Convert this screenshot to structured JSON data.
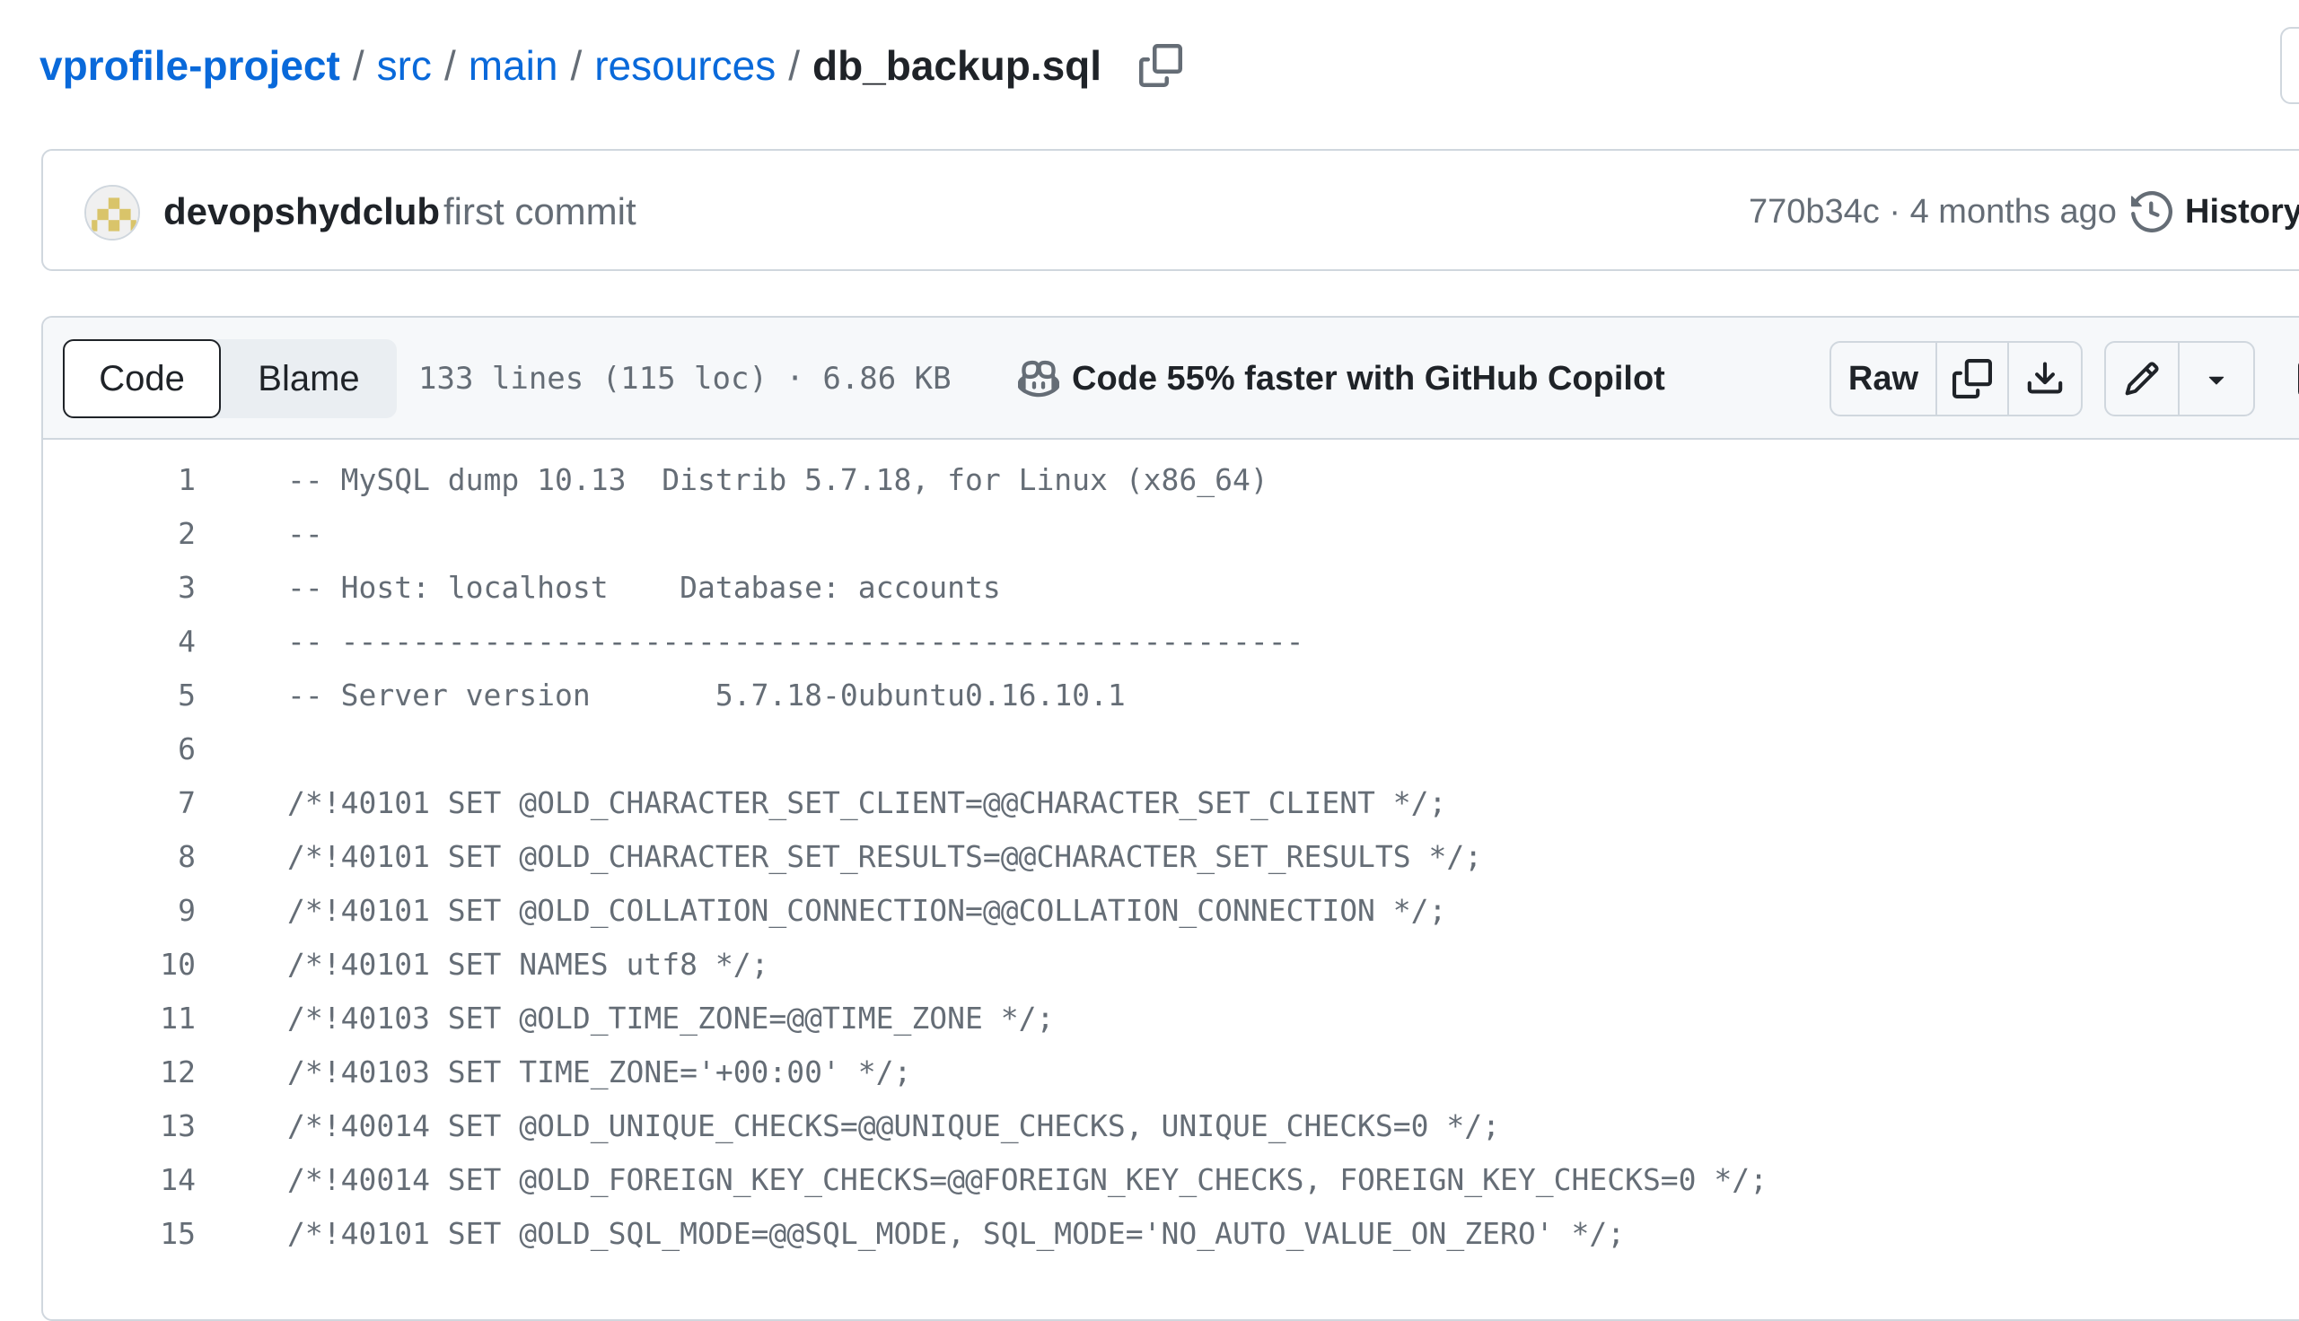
{
  "breadcrumb": {
    "repo": "vprofile-project",
    "separator": "/",
    "parts": [
      "src",
      "main",
      "resources"
    ],
    "file": "db_backup.sql"
  },
  "commit": {
    "author": "devopshydclub",
    "message": "first commit",
    "sha": "770b34c",
    "time_sep": "·",
    "time": "4 months ago",
    "history_label": "History"
  },
  "file_header": {
    "tabs": {
      "code": "Code",
      "blame": "Blame"
    },
    "info": "133 lines (115 loc) · 6.86 KB",
    "copilot": "Code 55% faster with GitHub Copilot",
    "raw": "Raw"
  },
  "code_lines": [
    {
      "n": "1",
      "text": "-- MySQL dump 10.13  Distrib 5.7.18, for Linux (x86_64)"
    },
    {
      "n": "2",
      "text": "--"
    },
    {
      "n": "3",
      "text": "-- Host: localhost    Database: accounts"
    },
    {
      "n": "4",
      "text": "-- ------------------------------------------------------"
    },
    {
      "n": "5",
      "text": "-- Server version\t5.7.18-0ubuntu0.16.10.1"
    },
    {
      "n": "6",
      "text": ""
    },
    {
      "n": "7",
      "text": "/*!40101 SET @OLD_CHARACTER_SET_CLIENT=@@CHARACTER_SET_CLIENT */;"
    },
    {
      "n": "8",
      "text": "/*!40101 SET @OLD_CHARACTER_SET_RESULTS=@@CHARACTER_SET_RESULTS */;"
    },
    {
      "n": "9",
      "text": "/*!40101 SET @OLD_COLLATION_CONNECTION=@@COLLATION_CONNECTION */;"
    },
    {
      "n": "10",
      "text": "/*!40101 SET NAMES utf8 */;"
    },
    {
      "n": "11",
      "text": "/*!40103 SET @OLD_TIME_ZONE=@@TIME_ZONE */;"
    },
    {
      "n": "12",
      "text": "/*!40103 SET TIME_ZONE='+00:00' */;"
    },
    {
      "n": "13",
      "text": "/*!40014 SET @OLD_UNIQUE_CHECKS=@@UNIQUE_CHECKS, UNIQUE_CHECKS=0 */;"
    },
    {
      "n": "14",
      "text": "/*!40014 SET @OLD_FOREIGN_KEY_CHECKS=@@FOREIGN_KEY_CHECKS, FOREIGN_KEY_CHECKS=0 */;"
    },
    {
      "n": "15",
      "text": "/*!40101 SET @OLD_SQL_MODE=@@SQL_MODE, SQL_MODE='NO_AUTO_VALUE_ON_ZERO' */;"
    }
  ],
  "icons": {
    "copy_path": "copy-icon",
    "history": "history-icon",
    "copilot": "copilot-icon",
    "copy_raw": "copy-icon",
    "download": "download-icon",
    "edit": "pencil-icon",
    "more": "triangle-down-icon",
    "symbols": "sidebar-expand-icon"
  },
  "colors": {
    "link": "#0969da",
    "text": "#1f2328",
    "muted": "#656d76",
    "border": "#d0d7de",
    "header_bg": "#f6f8fa"
  }
}
